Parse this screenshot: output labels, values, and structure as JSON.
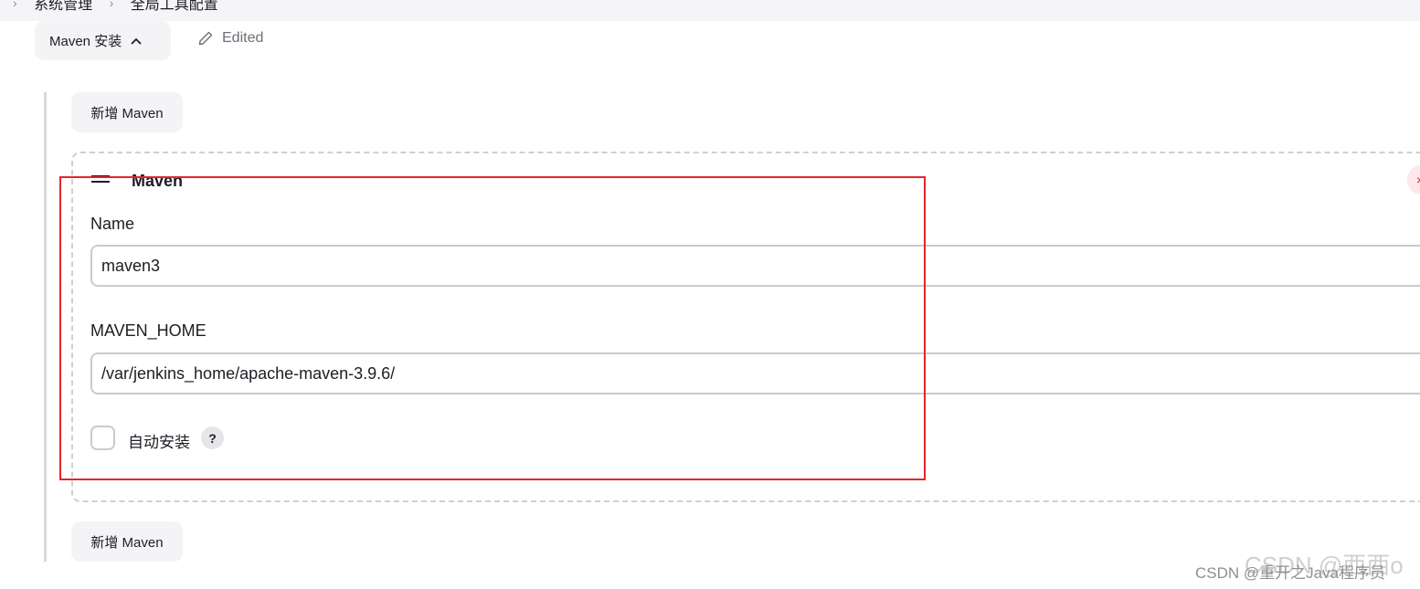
{
  "breadcrumb": {
    "items": [
      "系统管理",
      "全局工具配置"
    ]
  },
  "section": {
    "toggle_label": "Maven 安装",
    "edited_label": "Edited"
  },
  "add_button_label": "新增 Maven",
  "maven_item": {
    "title": "Maven",
    "delete_symbol": "×",
    "name_label": "Name",
    "name_value": "maven3",
    "home_label": "MAVEN_HOME",
    "home_value": "/var/jenkins_home/apache-maven-3.9.6/",
    "auto_install_label": "自动安装",
    "auto_install_checked": false,
    "help_symbol": "?"
  },
  "watermark": {
    "large": "CSDN @西西o",
    "small": "CSDN @重开之Java程序员"
  },
  "colors": {
    "highlight": "#e0262d",
    "button_bg": "#f4f4f6",
    "input_border": "#c6ccd0",
    "delete_bg": "#fde7e8",
    "delete_fg": "#d4222b"
  },
  "icons": [
    "chevron-up-icon",
    "pencil-icon",
    "drag-handle-icon",
    "close-icon",
    "help-icon"
  ]
}
